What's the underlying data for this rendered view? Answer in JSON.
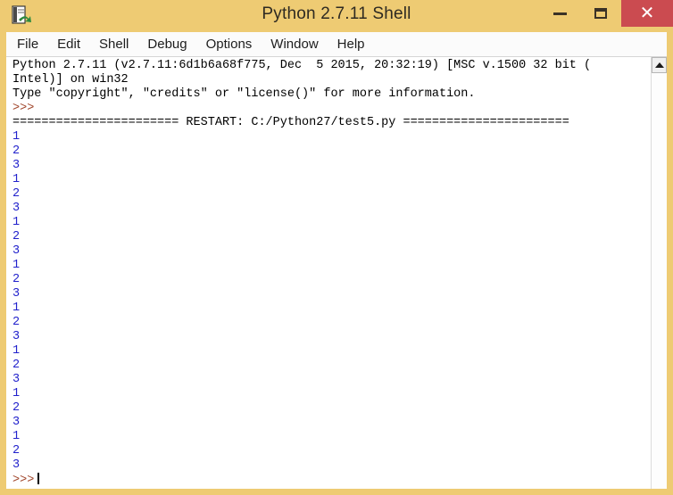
{
  "window": {
    "title": "Python 2.7.11 Shell",
    "icon": "idle-document-arrow-icon",
    "frame_color": "#eecb73",
    "controls": {
      "minimize_label": "—",
      "maximize_label": "❐",
      "close_label": "✕"
    }
  },
  "menubar": {
    "items": [
      {
        "label": "File"
      },
      {
        "label": "Edit"
      },
      {
        "label": "Shell"
      },
      {
        "label": "Debug"
      },
      {
        "label": "Options"
      },
      {
        "label": "Window"
      },
      {
        "label": "Help"
      }
    ]
  },
  "shell": {
    "colors": {
      "stdout": "#2222cc",
      "prompt": "#a0452a",
      "text": "#000000",
      "background": "#ffffff"
    },
    "header_lines": [
      "Python 2.7.11 (v2.7.11:6d1b6a68f775, Dec  5 2015, 20:32:19) [MSC v.1500 32 bit (",
      "Intel)] on win32",
      "Type \"copyright\", \"credits\" or \"license()\" for more information."
    ],
    "first_prompt": ">>>",
    "restart_banner": "======================= RESTART: C:/Python27/test5.py =======================",
    "output_lines": [
      "1",
      "2",
      "3",
      "1",
      "2",
      "3",
      "1",
      "2",
      "3",
      "1",
      "2",
      "3",
      "1",
      "2",
      "3",
      "1",
      "2",
      "3",
      "1",
      "2",
      "3",
      "1",
      "2",
      "3"
    ],
    "final_prompt": ">>>"
  },
  "scrollbar": {
    "up_arrow": "scroll-up-arrow"
  }
}
